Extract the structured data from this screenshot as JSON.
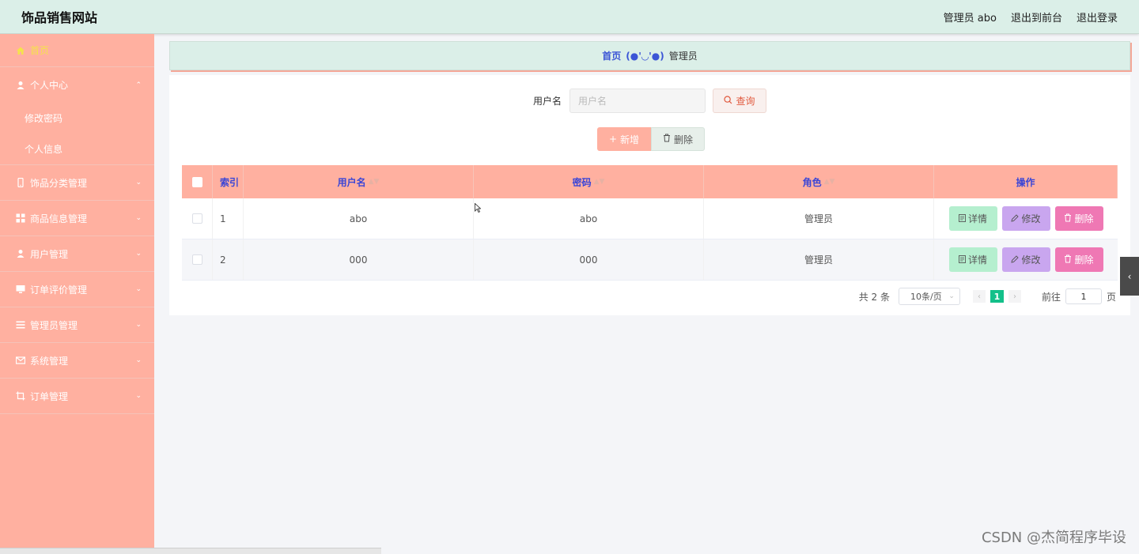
{
  "header": {
    "site_title": "饰品销售网站",
    "admin_label": "管理员 abo",
    "back_to_front": "退出到前台",
    "logout": "退出登录"
  },
  "sidebar": {
    "home": "首页",
    "personal_center": "个人中心",
    "sub_items": [
      "修改密码",
      "个人信息"
    ],
    "items": [
      "饰品分类管理",
      "商品信息管理",
      "用户管理",
      "订单评价管理",
      "管理员管理",
      "系统管理",
      "订单管理"
    ]
  },
  "breadcrumb": {
    "home": "首页",
    "face": "(●'◡'●)",
    "current": "管理员"
  },
  "search": {
    "label": "用户名",
    "placeholder": "用户名",
    "query_button": "查询"
  },
  "actions": {
    "add": "新增",
    "delete": "删除"
  },
  "table": {
    "headers": [
      "索引",
      "用户名",
      "密码",
      "角色",
      "操作"
    ],
    "rows": [
      {
        "index": "1",
        "username": "abo",
        "password": "abo",
        "role": "管理员"
      },
      {
        "index": "2",
        "username": "000",
        "password": "000",
        "role": "管理员"
      }
    ],
    "ops": {
      "detail": "详情",
      "edit": "修改",
      "delete": "删除"
    }
  },
  "pagination": {
    "total": "共 2 条",
    "page_size": "10条/页",
    "current_page": "1",
    "goto_label": "前往",
    "goto_value": "1",
    "page_unit": "页"
  },
  "watermark": "CSDN @杰简程序毕设",
  "colors": {
    "header_bg": "#dbefe8",
    "sidebar_bg": "#ffb0a0",
    "table_header_bg": "#ffb0a0",
    "header_text": "#3b46d6",
    "detail_btn": "#b5efcf",
    "edit_btn": "#c9a6ef",
    "delete_btn": "#ef78b4",
    "active_page": "#13c08a"
  }
}
